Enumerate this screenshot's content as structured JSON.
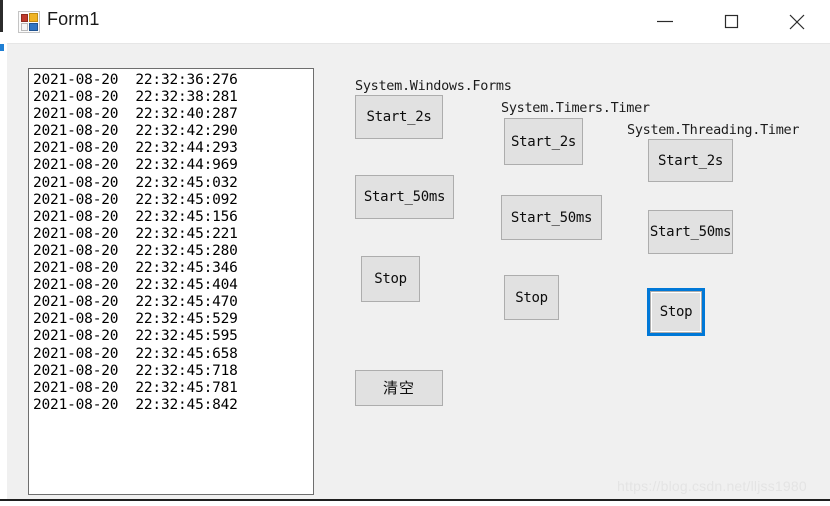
{
  "window": {
    "title": "Form1",
    "icon": "winforms-app-icon",
    "controls": {
      "minimize": "minimize-icon",
      "maximize": "maximize-icon",
      "close": "close-icon"
    }
  },
  "log_listbox": {
    "name": "timestamp-log-list",
    "lines": [
      "2021-08-20  22:32:36:276",
      "2021-08-20  22:32:38:281",
      "2021-08-20  22:32:40:287",
      "2021-08-20  22:32:42:290",
      "2021-08-20  22:32:44:293",
      "2021-08-20  22:32:44:969",
      "2021-08-20  22:32:45:032",
      "2021-08-20  22:32:45:092",
      "2021-08-20  22:32:45:156",
      "2021-08-20  22:32:45:221",
      "2021-08-20  22:32:45:280",
      "2021-08-20  22:32:45:346",
      "2021-08-20  22:32:45:404",
      "2021-08-20  22:32:45:470",
      "2021-08-20  22:32:45:529",
      "2021-08-20  22:32:45:595",
      "2021-08-20  22:32:45:658",
      "2021-08-20  22:32:45:718",
      "2021-08-20  22:32:45:781",
      "2021-08-20  22:32:45:842"
    ]
  },
  "groups": {
    "winforms": {
      "header": "System.Windows.Forms",
      "start_2s": "Start_2s",
      "start_50ms": "Start_50ms",
      "stop": "Stop"
    },
    "timers": {
      "header": "System.Timers.Timer",
      "start_2s": "Start_2s",
      "start_50ms": "Start_50ms",
      "stop": "Stop"
    },
    "threading": {
      "header": "System.Threading.Timer",
      "start_2s": "Start_2s",
      "start_50ms": "Start_50ms",
      "stop": "Stop"
    }
  },
  "clear_button": {
    "label": "清空"
  },
  "watermark": {
    "text": "https://blog.csdn.net/lljss1980"
  },
  "colors": {
    "form_background": "#f0f0f0",
    "button_face": "#e1e1e1",
    "button_border": "#adadad",
    "focus_ring": "#0078d7",
    "listbox_background": "#ffffff",
    "listbox_border": "#6e6e6e",
    "text": "#000000"
  }
}
